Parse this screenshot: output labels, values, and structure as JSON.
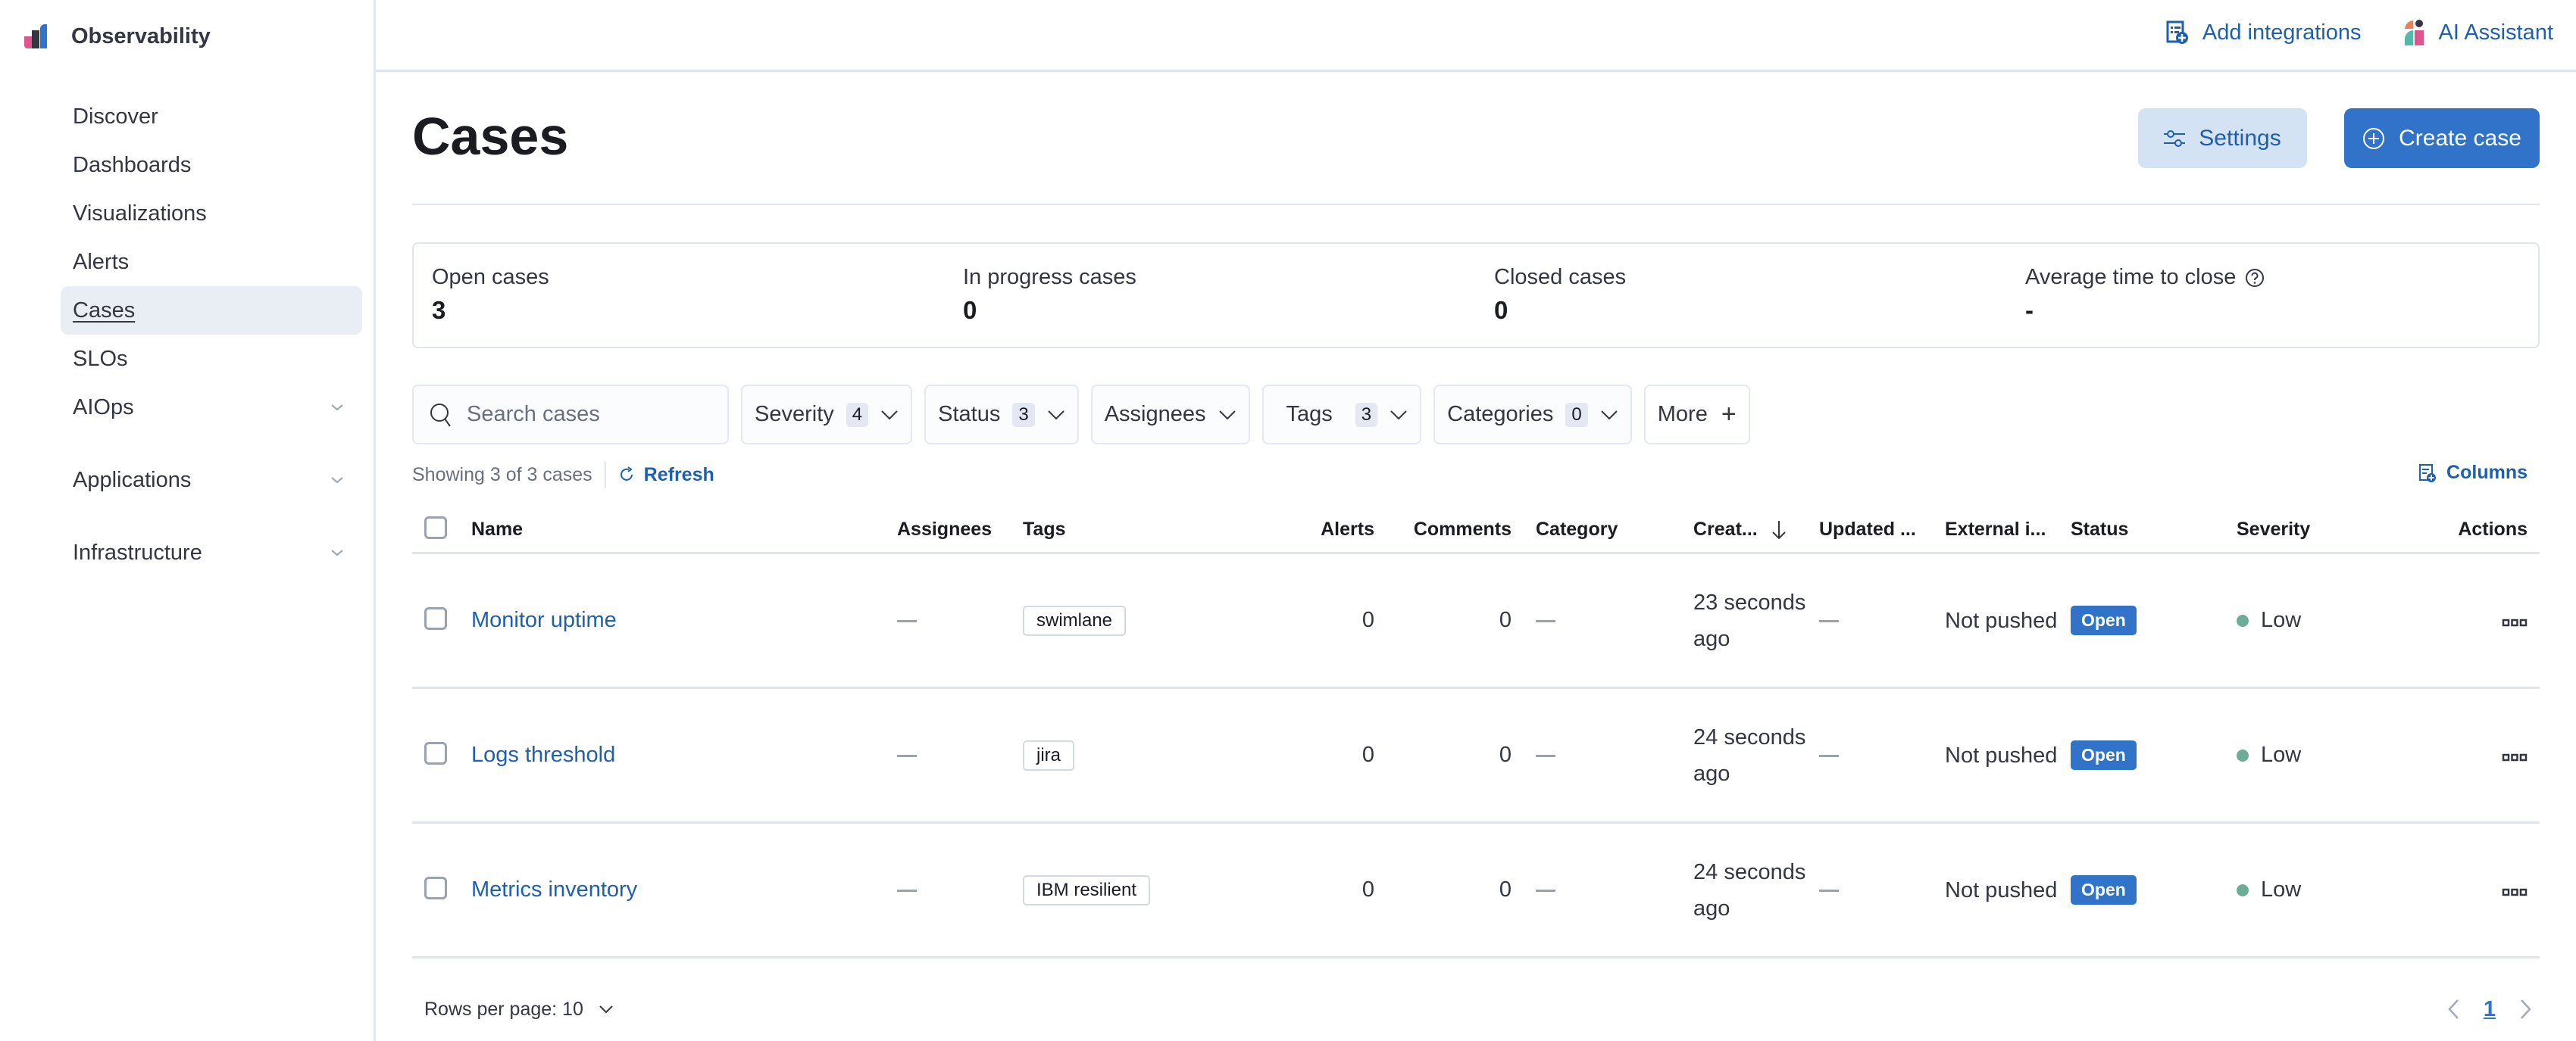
{
  "app": {
    "name": "Observability"
  },
  "sidebar": {
    "items": [
      {
        "label": "Discover"
      },
      {
        "label": "Dashboards"
      },
      {
        "label": "Visualizations"
      },
      {
        "label": "Alerts"
      },
      {
        "label": "Cases",
        "active": true
      },
      {
        "label": "SLOs"
      },
      {
        "label": "AIOps",
        "expandable": true
      }
    ],
    "groups": [
      {
        "label": "Applications"
      },
      {
        "label": "Infrastructure"
      }
    ]
  },
  "header": {
    "add_integrations": "Add integrations",
    "ai_assistant": "AI Assistant"
  },
  "page": {
    "title": "Cases",
    "settings_label": "Settings",
    "create_label": "Create case"
  },
  "stats": [
    {
      "label": "Open cases",
      "value": "3"
    },
    {
      "label": "In progress cases",
      "value": "0"
    },
    {
      "label": "Closed cases",
      "value": "0"
    },
    {
      "label": "Average time to close",
      "value": "-"
    }
  ],
  "filters": {
    "search_placeholder": "Search cases",
    "items": [
      {
        "label": "Severity",
        "count": "4"
      },
      {
        "label": "Status",
        "count": "3"
      },
      {
        "label": "Assignees",
        "count": null
      },
      {
        "label": "Tags",
        "count": "3"
      },
      {
        "label": "Categories",
        "count": "0"
      }
    ],
    "more_label": "More"
  },
  "summary": {
    "showing": "Showing 3 of 3 cases",
    "refresh": "Refresh",
    "columns": "Columns"
  },
  "table": {
    "headers": {
      "name": "Name",
      "assignees": "Assignees",
      "tags": "Tags",
      "alerts": "Alerts",
      "comments": "Comments",
      "category": "Category",
      "created": "Creat...",
      "updated": "Updated ...",
      "external": "External i...",
      "status": "Status",
      "severity": "Severity",
      "actions": "Actions"
    },
    "rows": [
      {
        "name": "Monitor uptime",
        "tag": "swimlane",
        "alerts": "0",
        "comments": "0",
        "created": "23 seconds ago",
        "external": "Not pushed",
        "status": "Open",
        "severity": "Low"
      },
      {
        "name": "Logs threshold",
        "tag": "jira",
        "alerts": "0",
        "comments": "0",
        "created": "24 seconds ago",
        "external": "Not pushed",
        "status": "Open",
        "severity": "Low"
      },
      {
        "name": "Metrics inventory",
        "tag": "IBM resilient",
        "alerts": "0",
        "comments": "0",
        "created": "24 seconds ago",
        "external": "Not pushed",
        "status": "Open",
        "severity": "Low"
      }
    ]
  },
  "pagination": {
    "rows_per_page": "Rows per page: 10",
    "current_page": "1"
  },
  "colors": {
    "accent": "#3073c8",
    "link": "#1f5fb0",
    "severity_low": "#6dad98",
    "active_nav_bg": "#e9edf4"
  }
}
